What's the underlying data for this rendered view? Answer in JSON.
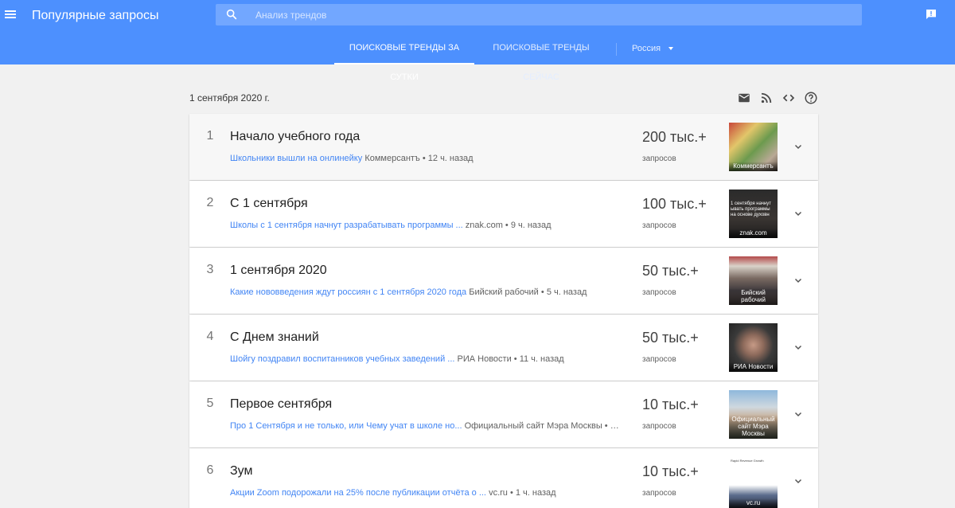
{
  "header": {
    "title": "Популярные запросы",
    "search_placeholder": "Анализ трендов"
  },
  "tabs": {
    "daily": "ПОИСКОВЫЕ ТРЕНДЫ ЗА СУТКИ",
    "realtime": "ПОИСКОВЫЕ ТРЕНДЫ СЕЙЧАС",
    "geo": "Россия"
  },
  "date": "1 сентября 2020 г.",
  "colors": {
    "header": "#4d90fe",
    "link": "#4285f4",
    "background": "#f1f1f1"
  },
  "trends": [
    {
      "rank": "1",
      "title": "Начало учебного года",
      "article": "Школьники вышли на онлинейку",
      "source": "Коммерсантъ",
      "time": "12 ч. назад",
      "count": "200 тыс.+",
      "count_label": "запросов",
      "thumb_caption": "Коммерсантъ",
      "thumb_text": ""
    },
    {
      "rank": "2",
      "title": "С 1 сентября",
      "article": "Школы с 1 сентября начнут разрабатывать программы ...",
      "source": "znak.com",
      "time": "9 ч. назад",
      "count": "100 тыс.+",
      "count_label": "запросов",
      "thumb_caption": "znak.com",
      "thumb_text": "1 сентября начнут ывать программы на основе духовн"
    },
    {
      "rank": "3",
      "title": "1 сентября 2020",
      "article": "Какие нововведения ждут россиян с 1 сентября 2020 года",
      "source": "Бийский рабочий",
      "time": "5 ч. назад",
      "count": "50 тыс.+",
      "count_label": "запросов",
      "thumb_caption": "Бийский рабочий",
      "thumb_text": ""
    },
    {
      "rank": "4",
      "title": "С Днем знаний",
      "article": "Шойгу поздравил воспитанников учебных заведений ...",
      "source": "РИА Новости",
      "time": "11 ч. назад",
      "count": "50 тыс.+",
      "count_label": "запросов",
      "thumb_caption": "РИА Новости",
      "thumb_text": ""
    },
    {
      "rank": "5",
      "title": "Первое сентября",
      "article": "Про 1 Сентября и не только, или Чему учат в школе но...",
      "source": "Официальный сайт Мэра Москвы",
      "time": "…",
      "count": "10 тыс.+",
      "count_label": "запросов",
      "thumb_caption": "Официальный сайт Мэра Москвы",
      "thumb_text": ""
    },
    {
      "rank": "6",
      "title": "Зум",
      "article": "Акции Zoom подорожали на 25% после публикации отчёта о ...",
      "source": "vc.ru",
      "time": "1 ч. назад",
      "count": "10 тыс.+",
      "count_label": "запросов",
      "thumb_caption": "vc.ru",
      "thumb_text": "Rapid Revenue Growth"
    }
  ]
}
